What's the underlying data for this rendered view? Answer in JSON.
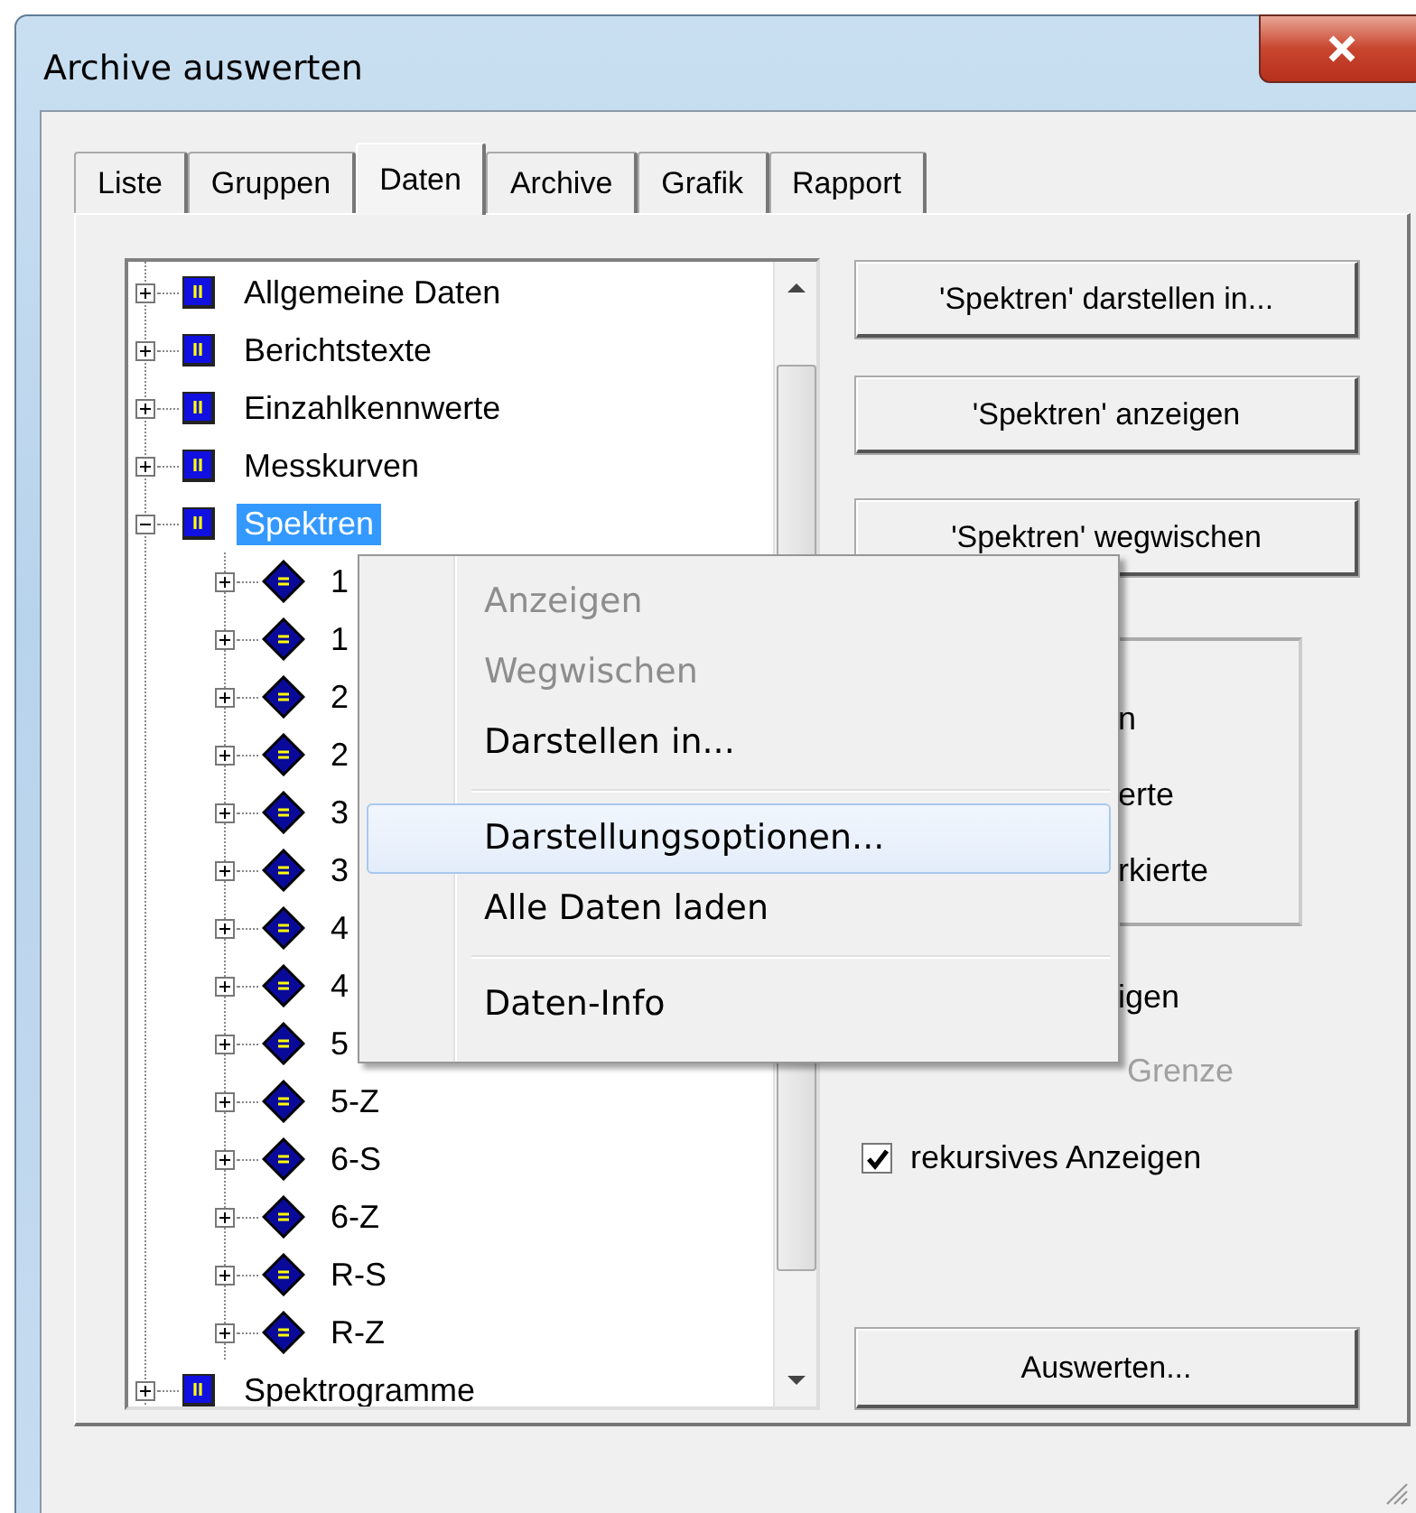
{
  "window": {
    "title": "Archive auswerten"
  },
  "tabs": [
    {
      "label": "Liste",
      "selected": false
    },
    {
      "label": "Gruppen",
      "selected": false
    },
    {
      "label": "Daten",
      "selected": true
    },
    {
      "label": "Archive",
      "selected": false
    },
    {
      "label": "Grafik",
      "selected": false
    },
    {
      "label": "Rapport",
      "selected": false
    }
  ],
  "tree": [
    {
      "label": "Allgemeine Daten",
      "expanded": false,
      "selected": false
    },
    {
      "label": "Berichtstexte",
      "expanded": false,
      "selected": false
    },
    {
      "label": "Einzahlkennwerte",
      "expanded": false,
      "selected": false
    },
    {
      "label": "Messkurven",
      "expanded": false,
      "selected": false
    },
    {
      "label": "Spektren",
      "expanded": true,
      "selected": true,
      "children": [
        {
          "label": "1",
          "expanded": false
        },
        {
          "label": "1",
          "expanded": false
        },
        {
          "label": "2",
          "expanded": false
        },
        {
          "label": "2",
          "expanded": false
        },
        {
          "label": "3",
          "expanded": false
        },
        {
          "label": "3",
          "expanded": false
        },
        {
          "label": "4",
          "expanded": false
        },
        {
          "label": "4",
          "expanded": false
        },
        {
          "label": "5",
          "expanded": false
        },
        {
          "label": "5-Z",
          "expanded": false
        },
        {
          "label": "6-S",
          "expanded": false
        },
        {
          "label": "6-Z",
          "expanded": false
        },
        {
          "label": "R-S",
          "expanded": false
        },
        {
          "label": "R-Z",
          "expanded": false
        }
      ]
    },
    {
      "label": "Spektrogramme",
      "expanded": false,
      "selected": false
    }
  ],
  "buttons": [
    "'Spektren' darstellen in...",
    "'Spektren' anzeigen",
    "'Spektren' wegwischen"
  ],
  "group_options": [
    "n",
    "erte",
    "rkierte"
  ],
  "options": [
    {
      "kind": "text",
      "label": "igen",
      "disabled": false
    },
    {
      "kind": "text",
      "label": "Grenze",
      "disabled": true
    },
    {
      "kind": "checkbox",
      "label": "rekursives Anzeigen",
      "checked": true
    }
  ],
  "evaluate_button": "Auswerten...",
  "context_menu": [
    {
      "kind": "item",
      "label": "Anzeigen",
      "disabled": true,
      "selected": false
    },
    {
      "kind": "item",
      "label": "Wegwischen",
      "disabled": true,
      "selected": false
    },
    {
      "kind": "item",
      "label": "Darstellen in...",
      "disabled": false,
      "selected": false
    },
    {
      "kind": "separator"
    },
    {
      "kind": "item",
      "label": "Darstellungsoptionen...",
      "disabled": false,
      "selected": true
    },
    {
      "kind": "item",
      "label": "Alle Daten laden",
      "disabled": false,
      "selected": false
    },
    {
      "kind": "separator"
    },
    {
      "kind": "item",
      "label": "Daten-Info",
      "disabled": false,
      "selected": false
    }
  ]
}
